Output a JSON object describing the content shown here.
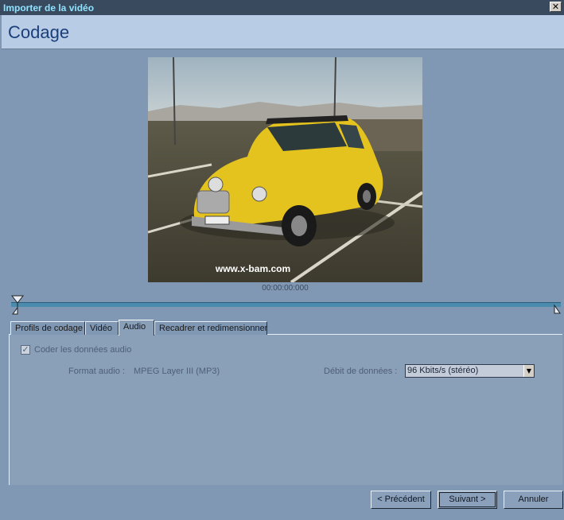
{
  "window": {
    "title": "Importer de la vidéo",
    "close_glyph": "✕"
  },
  "header": {
    "title": "Codage"
  },
  "preview": {
    "watermark": "www.x-bam.com",
    "timecode": "00:00:00:000"
  },
  "tabs": [
    {
      "label": "Profils de codage",
      "active": false
    },
    {
      "label": "Vidéo",
      "active": false
    },
    {
      "label": "Audio",
      "active": true
    },
    {
      "label": "Recadrer et redimensionner",
      "active": false
    }
  ],
  "audio": {
    "encode_checkbox": {
      "label": "Coder les données audio",
      "checked": true,
      "check_glyph": "✓"
    },
    "format_label": "Format audio :",
    "format_value": "MPEG Layer III (MP3)",
    "bitrate_label": "Débit de données :",
    "bitrate_value": "96 Kbits/s (stéréo)",
    "dropdown_glyph": "▼"
  },
  "buttons": {
    "previous": "< Précédent",
    "next": "Suivant >",
    "cancel": "Annuler"
  },
  "colors": {
    "accent": "#4b8cae",
    "title_text": "#1b3f7a",
    "background": "#8098b3"
  }
}
